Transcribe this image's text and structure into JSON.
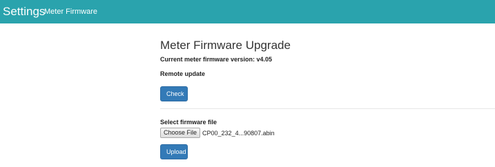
{
  "header": {
    "brand": "Settings",
    "subtitle": "Meter Firmware"
  },
  "firmware": {
    "title": "Meter Firmware Upgrade",
    "current_version": "Current meter firmware version: v4.05",
    "remote_label": "Remote update",
    "check_label": "Check",
    "select_label": "Select firmware file",
    "choose_file_label": "Choose File",
    "file_name": "CP00_232_4...90807.abin",
    "upload_label": "Upload"
  },
  "colors": {
    "header_bg": "#2aa3ad",
    "button_primary": "#337ab7"
  }
}
